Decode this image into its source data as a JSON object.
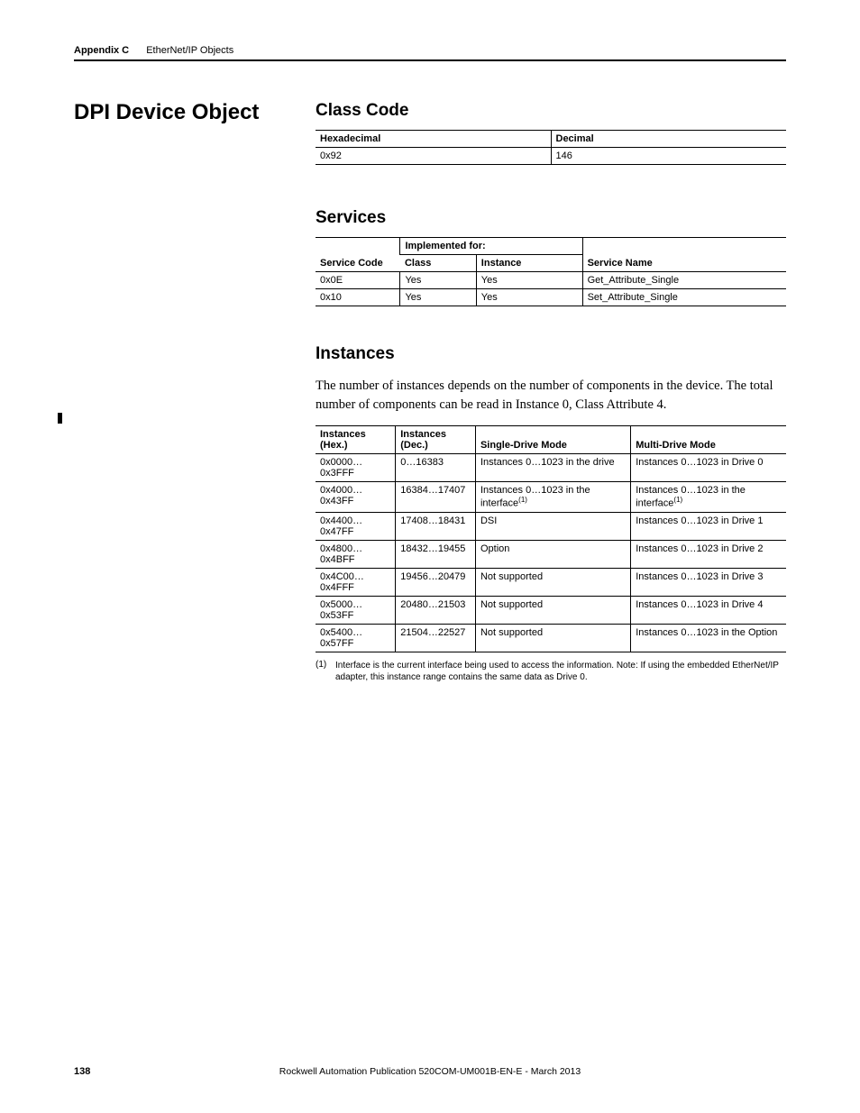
{
  "header": {
    "appendix": "Appendix C",
    "chapter": "EtherNet/IP Objects"
  },
  "section_title": "DPI Device Object",
  "classcode": {
    "heading": "Class Code",
    "head_hex": "Hexadecimal",
    "head_dec": "Decimal",
    "hex": "0x92",
    "dec": "146"
  },
  "services": {
    "heading": "Services",
    "head_code": "Service Code",
    "head_impl": "Implemented for:",
    "head_class": "Class",
    "head_instance": "Instance",
    "head_name": "Service Name",
    "rows": [
      {
        "code": "0x0E",
        "class": "Yes",
        "instance": "Yes",
        "name": "Get_Attribute_Single"
      },
      {
        "code": "0x10",
        "class": "Yes",
        "instance": "Yes",
        "name": "Set_Attribute_Single"
      }
    ]
  },
  "instances": {
    "heading": "Instances",
    "body": "The number of instances depends on the number of components in the device. The total number of components can be read in Instance 0, Class Attribute 4.",
    "head_hex": "Instances (Hex.)",
    "head_dec": "Instances (Dec.)",
    "head_single": "Single-Drive Mode",
    "head_multi": "Multi-Drive Mode",
    "rows": [
      {
        "hex": "0x0000…0x3FFF",
        "dec": "0…16383",
        "single": "Instances 0…1023 in the drive",
        "multi": "Instances 0…1023 in Drive 0",
        "single_sup": "",
        "multi_sup": ""
      },
      {
        "hex": "0x4000…0x43FF",
        "dec": "16384…17407",
        "single": "Instances 0…1023 in the interface",
        "multi": "Instances 0…1023 in the interface",
        "single_sup": "(1)",
        "multi_sup": "(1)"
      },
      {
        "hex": "0x4400…0x47FF",
        "dec": "17408…18431",
        "single": "DSI",
        "multi": "Instances 0…1023 in Drive 1",
        "single_sup": "",
        "multi_sup": ""
      },
      {
        "hex": "0x4800…0x4BFF",
        "dec": "18432…19455",
        "single": "Option",
        "multi": "Instances 0…1023 in Drive 2",
        "single_sup": "",
        "multi_sup": ""
      },
      {
        "hex": "0x4C00…0x4FFF",
        "dec": "19456…20479",
        "single": "Not supported",
        "multi": "Instances 0…1023 in Drive 3",
        "single_sup": "",
        "multi_sup": ""
      },
      {
        "hex": "0x5000…0x53FF",
        "dec": "20480…21503",
        "single": "Not supported",
        "multi": "Instances 0…1023 in Drive 4",
        "single_sup": "",
        "multi_sup": ""
      },
      {
        "hex": "0x5400…0x57FF",
        "dec": "21504…22527",
        "single": "Not supported",
        "multi": "Instances 0…1023 in the Option",
        "single_sup": "",
        "multi_sup": ""
      }
    ],
    "footnote_num": "(1)",
    "footnote_text": "Interface is the current interface being used to access the information. Note: If using the embedded EtherNet/IP adapter, this instance range contains the same data as Drive 0."
  },
  "footer": {
    "page": "138",
    "pub": "Rockwell Automation Publication 520COM-UM001B-EN-E - March 2013"
  }
}
